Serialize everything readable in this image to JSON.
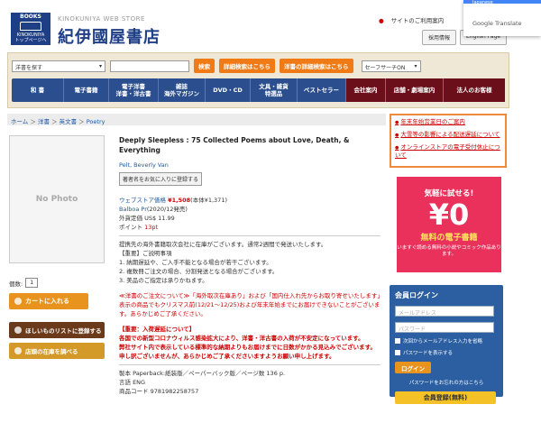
{
  "header": {
    "logo_top": "BOOKS",
    "logo_bottom": "KINOKUNIYA",
    "logo_sub": "トップページへ",
    "web_store": "KINOKUNIYA WEB STORE",
    "store_name": "紀伊國屋書店",
    "top_links": [
      "サイトのご利用案内"
    ],
    "buttons": [
      "採用情報",
      "English Page"
    ],
    "translate_label": "Google Translate",
    "translate_tab": "Japanese"
  },
  "search": {
    "select_value": "洋書を探す",
    "search_button": "検索",
    "detail_search": "詳細検索はこちら",
    "foreign_detail_search": "洋書の詳細検索はこちら",
    "safe_search": "セーフサーチON"
  },
  "menu": [
    "和 書",
    "電子書籍",
    "電子洋書\n洋書・洋古書",
    "雑誌\n海外マガジン",
    "DVD・CD",
    "文具・雑貨\n特選品",
    "ベストセラー",
    "会社案内",
    "店舗・劇場案内",
    "法人のお客様"
  ],
  "breadcrumb": [
    "ホーム",
    "洋書",
    "英文書",
    "Poetry"
  ],
  "left": {
    "no_photo": "No Photo",
    "qty_label": "個数:",
    "qty_value": "1",
    "cart_button": "カートに入れる",
    "wishlist_button": "ほしいものリストに登録する",
    "store_stock_button": "店頭の在庫を調べる"
  },
  "product": {
    "title": "Deeply Sleepless : 75 Collected Poems about Love, Death, & Everything",
    "author": "Pelt, Beverly Van",
    "fav_author_button": "著者名をお気に入りに登録する",
    "price_label": "ウェブストア価格",
    "price": "¥1,508",
    "price_tax": "(本体¥1,371)",
    "publisher": "Balboa Pr",
    "pub_date": "(2020/12発売)",
    "fx_price": "外貨定価 US$ 11.99",
    "points_label": "ポイント",
    "points": "13pt",
    "stock_msg": "提携先の海外書籍取次会社に在庫がございます。通常2週間で発送いたします。",
    "notes_head": "【重要】ご説明事項",
    "notes": [
      "1. 納期遅延や、ご入手不能となる場合が若干ございます。",
      "2. 複数冊ご注文の場合、分割発送となる場合がございます。",
      "3. 美品のご指定は承りかねます。"
    ],
    "xmas_notice": "≪洋書のご注文について≫「海外取次在庫あり」および「国内仕入れ先からお取り寄せいたします」表示の商品でもクリスマス前(12/21～12/25)および年末年始までにお届けできないことがございます。あらかじめご了承ください。",
    "covid_head": "【重要：入荷遅延について】",
    "covid_body": "各国での新型コロナウィルス感染拡大により、洋書・洋古書の入荷が不安定になっています。",
    "covid_body2": "弊社サイト内で表示している標準的な納期よりもお届けまでに日数がかかる見込みでございます。",
    "covid_body3": "申し訳ございませんが、あらかじめご了承くださいますようお願い申し上げます。",
    "spec_format": "製本 Paperback:紙装版／ペーパーバック版／ページ数 136 p.",
    "spec_lang": "言語 ENG",
    "spec_code": "商品コード 9781982258757"
  },
  "right": {
    "notices": [
      "年末年始営業日のご案内",
      "大雪等の影響による配送遅延について",
      "オンラインストアの電子受付休止について"
    ],
    "ad": {
      "line1": "気軽に試せる!",
      "line2": "¥0",
      "line3": "無料の電子書籍",
      "line4": "いますぐ読める無料の小説やコミック作品あります。"
    },
    "login": {
      "title": "会員ログイン",
      "email_placeholder": "メールアドレス",
      "password_placeholder": "パスワード",
      "save_email": "次回からメールアドレス入力を省略",
      "show_password": "パスワードを表示する",
      "login_button": "ログイン",
      "forgot": "パスワードをお忘れの方はこちら",
      "register": "会員登録(無料)"
    }
  }
}
